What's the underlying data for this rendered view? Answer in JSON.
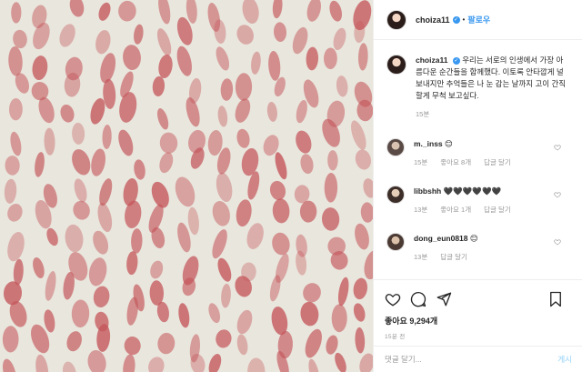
{
  "post": {
    "username": "choiza11",
    "verified_glyph": "✓",
    "separator": "•",
    "follow_label": "팔로우"
  },
  "comments": [
    {
      "username": "choiza11",
      "text": "우리는 서로의 인생에서 가장 아름다운 순간들을 함께했다. 이토록 안타깝게 널 보내지만 추억들은 나 눈 감는 날까지 고이 간직할게 무척 보고싶다.",
      "time": "15분",
      "likes": "",
      "reply": ""
    },
    {
      "username": "m._inss",
      "text": "😊",
      "time": "15분",
      "likes": "좋아요 8개",
      "reply": "답글 달기"
    },
    {
      "username": "libbshh",
      "text": "🖤🖤🖤🖤🖤🖤",
      "time": "13분",
      "likes": "좋아요 1개",
      "reply": "답글 달기"
    },
    {
      "username": "dong_eun0818",
      "text": "😊",
      "time": "13분",
      "likes": "",
      "reply": "답글 달기"
    }
  ],
  "actions": {
    "icons": [
      "heart-icon",
      "comment-icon",
      "share-icon",
      "bookmark-icon"
    ],
    "likes_text": "좋아요 9,294개",
    "time_ago": "15분 전"
  },
  "add_comment": {
    "placeholder": "댓글 달기...",
    "post_label": "게시"
  },
  "colors": {
    "accent": "#3897f0",
    "muted": "#999999",
    "border": "#efefef",
    "photo_bg": "#e9e6dd",
    "paint": "#c4555a"
  }
}
